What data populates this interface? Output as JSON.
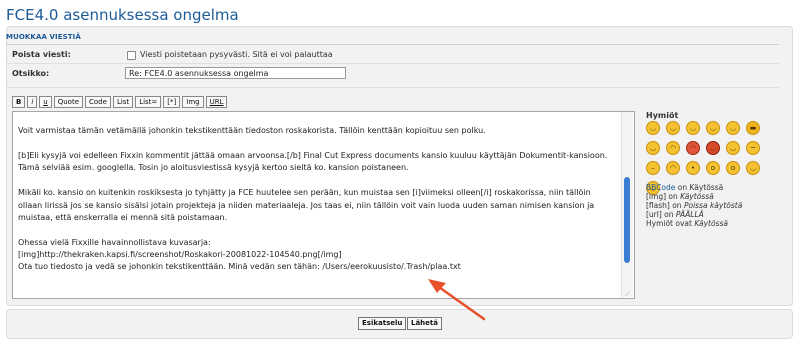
{
  "page_title": "FCE4.0 asennuksessa ongelma",
  "panel_header": "MUOKKAA VIESTIÄ",
  "delete": {
    "label": "Poista viesti:",
    "note": "Viesti poistetaan pysyvästi. Sitä ei voi palauttaa"
  },
  "subject": {
    "label": "Otsikko:",
    "value": "Re: FCE4.0 asennuksessa ongelma"
  },
  "toolbar": [
    "B",
    "i",
    "u",
    "Quote",
    "Code",
    "List",
    "List=",
    "[*]",
    "Img",
    "URL"
  ],
  "editor_lines": [
    "Voit varmistaa tämän vetämällä johonkin tekstikenttään tiedoston roskakorista. Tällöin kenttään kopioituu sen polku.",
    "",
    "[b]Eli kysyjä voi edelleen Fixxin kommentit jättää omaan arvoonsa.[/b] Final Cut Express documents kansio kuuluu käyttäjän Dokumentit-kansioon.",
    "Tämä selviää esim. googlella. Tosin jo aloitusviestissä kysyjä kertoo sieltä ko. kansion poistaneen.",
    "",
    "Mikäli ko. kansio on kuitenkin roskiksesta jo tyhjätty ja FCE huutelee sen perään, kun muistaa sen [i]viimeksi olleen[/i] roskakorissa, niin tällöin",
    "ollaan lirissä jos se kansio sisälsi jotain projekteja ja niiden materiaaleja. Jos taas ei, niin tällöin voit vain luoda uuden saman nimisen kansion ja",
    "muistaa, että enskerralla ei mennä sitä poistamaan.",
    "",
    "Ohessa vielä Fixxille havainnollistava kuvasarja:",
    "[img]http://thekraken.kapsi.fi/screenshot/Roskakori-20081022-104540.png[/img]",
    "Ota tuo tiedosto ja vedä se johonkin tekstikenttään. Minä vedän sen tähän: /Users/eerokuusisto/.Trash/plaa.txt"
  ],
  "smilies_title": "Hymiöt",
  "smilies": [
    "smile",
    "grin",
    "wink",
    "laugh",
    "happy",
    "cool",
    "lol",
    "sad",
    "angry",
    "devil",
    "tongue",
    "confused",
    "neutral",
    "cry",
    "kiss",
    "shocked",
    "surprised",
    "roll-eyes",
    "embarrassed"
  ],
  "bbcode_status": {
    "bbcode_link": "BBCode",
    "bbcode_state": "on Käytössä",
    "img_label": "[img] on",
    "img_state": "Käytössä",
    "flash_label": "[flash] on",
    "flash_state": "Poissa käytöstä",
    "url_label": "[url] on",
    "url_state": "PÄÄLLÄ",
    "smilies_label": "Hymiöt ovat",
    "smilies_state": "Käytössä"
  },
  "buttons": {
    "preview": "Esikatselu",
    "submit": "Lähetä"
  },
  "colors": {
    "title": "#1c5a98",
    "arrow": "#e8502c",
    "scroll_thumb": "#3d7ed6"
  }
}
